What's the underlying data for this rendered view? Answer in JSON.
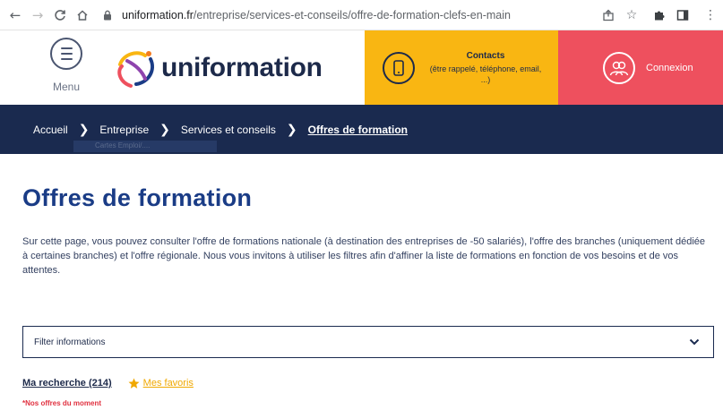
{
  "browser": {
    "url_host": "uniformation.fr",
    "url_path": "/entreprise/services-et-conseils/offre-de-formation-clefs-en-main"
  },
  "header": {
    "menu_label": "Menu",
    "logo_text": "uniformation",
    "contacts_title": "Contacts",
    "contacts_sub": "(être rappelé, téléphone, email, ...)",
    "connexion_label": "Connexion"
  },
  "breadcrumb": {
    "items": [
      "Accueil",
      "Entreprise",
      "Services et conseils",
      "Offres de formation"
    ],
    "dropdown_hint": "Cartes Emploi/...."
  },
  "main": {
    "title": "Offres de formation",
    "intro": "Sur cette page, vous pouvez consulter l'offre de formations nationale (à destination des entreprises de -50 salariés), l'offre des branches (uniquement dédiée à certaines branches) et l'offre régionale. Nous vous invitons à utiliser les filtres afin d'affiner la liste de formations en fonction de vos besoins et de vos attentes.",
    "filter_label": "Filter informations",
    "ma_recherche": "Ma recherche (214)",
    "mes_favoris": "Mes favoris",
    "offres_moment": "*Nos offres du moment"
  },
  "colors": {
    "navy": "#1a2a4f",
    "title_blue": "#1a3c86",
    "contacts_yellow": "#f9b612",
    "connexion_red": "#ee505e",
    "favoris_orange": "#f0a800",
    "alert_red": "#e0303f"
  },
  "icons": {
    "back": "arrow-left-icon",
    "forward": "arrow-right-icon",
    "reload": "reload-icon",
    "home": "home-icon",
    "lock": "lock-icon",
    "share": "share-icon",
    "bookmark": "star-outline-icon",
    "extensions": "puzzle-icon",
    "sidepanel": "side-panel-icon",
    "more": "kebab-icon",
    "menu": "hamburger-icon",
    "phone": "phone-icon",
    "user": "users-icon",
    "chevron": "chevron-down-icon",
    "favorite": "star-icon"
  }
}
